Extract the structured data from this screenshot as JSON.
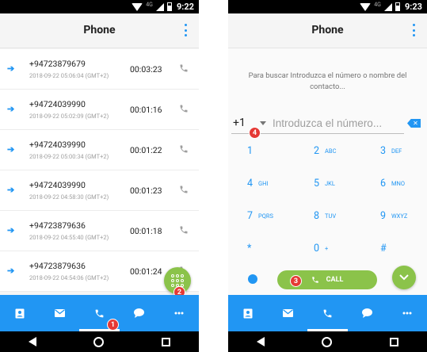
{
  "status": {
    "network": "4G",
    "time_left": "9:22",
    "time_right": "9:23"
  },
  "appbar": {
    "title": "Phone"
  },
  "calls": [
    {
      "number": "+94723879679",
      "datetime": "2018-09-22 05:06:04 (GMT+2)",
      "duration": "00:03:23"
    },
    {
      "number": "+94724039990",
      "datetime": "2018-09-22 05:02:09 (GMT+2)",
      "duration": "00:01:16"
    },
    {
      "number": "+94724039990",
      "datetime": "2018-09-22 05:00:34 (GMT+2)",
      "duration": "00:01:22"
    },
    {
      "number": "+94724039990",
      "datetime": "2018-09-22 04:58:30 (GMT+2)",
      "duration": "00:01:23"
    },
    {
      "number": "+94723879636",
      "datetime": "2018-09-22 04:55:40 (GMT+2)",
      "duration": "00:01:18"
    },
    {
      "number": "+94723879636",
      "datetime": "2018-09-22 04:54:06 (GMT+2)",
      "duration": "00:01:24"
    }
  ],
  "badges": [
    "1",
    "2",
    "3",
    "4"
  ],
  "dialer": {
    "hint": "Para buscar Introduzca el número o nombre del contacto...",
    "country_code": "+1",
    "placeholder": "Introduzca el número...",
    "call_label": "CALL",
    "keys": [
      {
        "digit": "1",
        "letters": ""
      },
      {
        "digit": "2",
        "letters": "ABC"
      },
      {
        "digit": "3",
        "letters": "DEF"
      },
      {
        "digit": "4",
        "letters": "GHI"
      },
      {
        "digit": "5",
        "letters": "JKL"
      },
      {
        "digit": "6",
        "letters": "MNO"
      },
      {
        "digit": "7",
        "letters": "PQRS"
      },
      {
        "digit": "8",
        "letters": "TUV"
      },
      {
        "digit": "9",
        "letters": "WXYZ"
      },
      {
        "digit": "*",
        "letters": ""
      },
      {
        "digit": "0",
        "letters": "+"
      },
      {
        "digit": "#",
        "letters": ""
      }
    ]
  },
  "colors": {
    "accent": "#2196f3",
    "fab": "#8bc34a",
    "badge": "#e53935"
  },
  "bottomnav_icons": [
    "contacts-icon",
    "email-icon",
    "phone-icon",
    "chat-icon",
    "more-icon"
  ]
}
